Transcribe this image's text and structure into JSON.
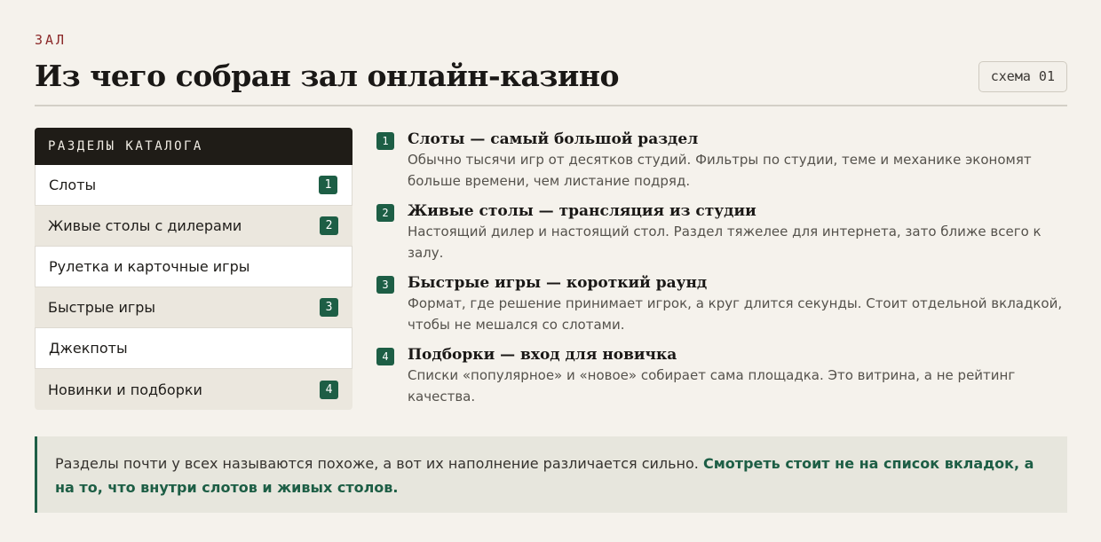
{
  "header": {
    "eyebrow": "ЗАЛ",
    "title": "Из чего собран зал онлайн-казино",
    "tag": "схема 01"
  },
  "catalog": {
    "heading": "РАЗДЕЛЫ КАТАЛОГА",
    "rows": [
      {
        "label": "Слоты",
        "badge": "1"
      },
      {
        "label": "Живые столы с дилерами",
        "badge": "2"
      },
      {
        "label": "Рулетка и карточные игры",
        "badge": ""
      },
      {
        "label": "Быстрые игры",
        "badge": "3"
      },
      {
        "label": "Джекпоты",
        "badge": ""
      },
      {
        "label": "Новинки и подборки",
        "badge": "4"
      }
    ]
  },
  "items": [
    {
      "num": "1",
      "title": "Слоты — самый большой раздел",
      "desc": "Обычно тысячи игр от десятков студий. Фильтры по студии, теме и механике экономят больше времени, чем листание подряд."
    },
    {
      "num": "2",
      "title": "Живые столы — трансляция из студии",
      "desc": "Настоящий дилер и настоящий стол. Раздел тяжелее для интернета, зато ближе всего к залу."
    },
    {
      "num": "3",
      "title": "Быстрые игры — короткий раунд",
      "desc": "Формат, где решение принимает игрок, а круг длится секунды. Стоит отдельной вкладкой, чтобы не мешался со слотами."
    },
    {
      "num": "4",
      "title": "Подборки — вход для новичка",
      "desc": "Списки «популярное» и «новое» собирает сама площадка. Это витрина, а не рейтинг качества."
    }
  ],
  "note": {
    "text": "Разделы почти у всех называются похоже, а вот их наполнение различается сильно. ",
    "accent": "Смотреть стоит не на список вкладок, а на то, что внутри слотов и живых столов."
  },
  "colors": {
    "accent_green": "#1d5e45",
    "eyebrow_red": "#8c2a2a",
    "dark_header": "#1f1c17"
  }
}
